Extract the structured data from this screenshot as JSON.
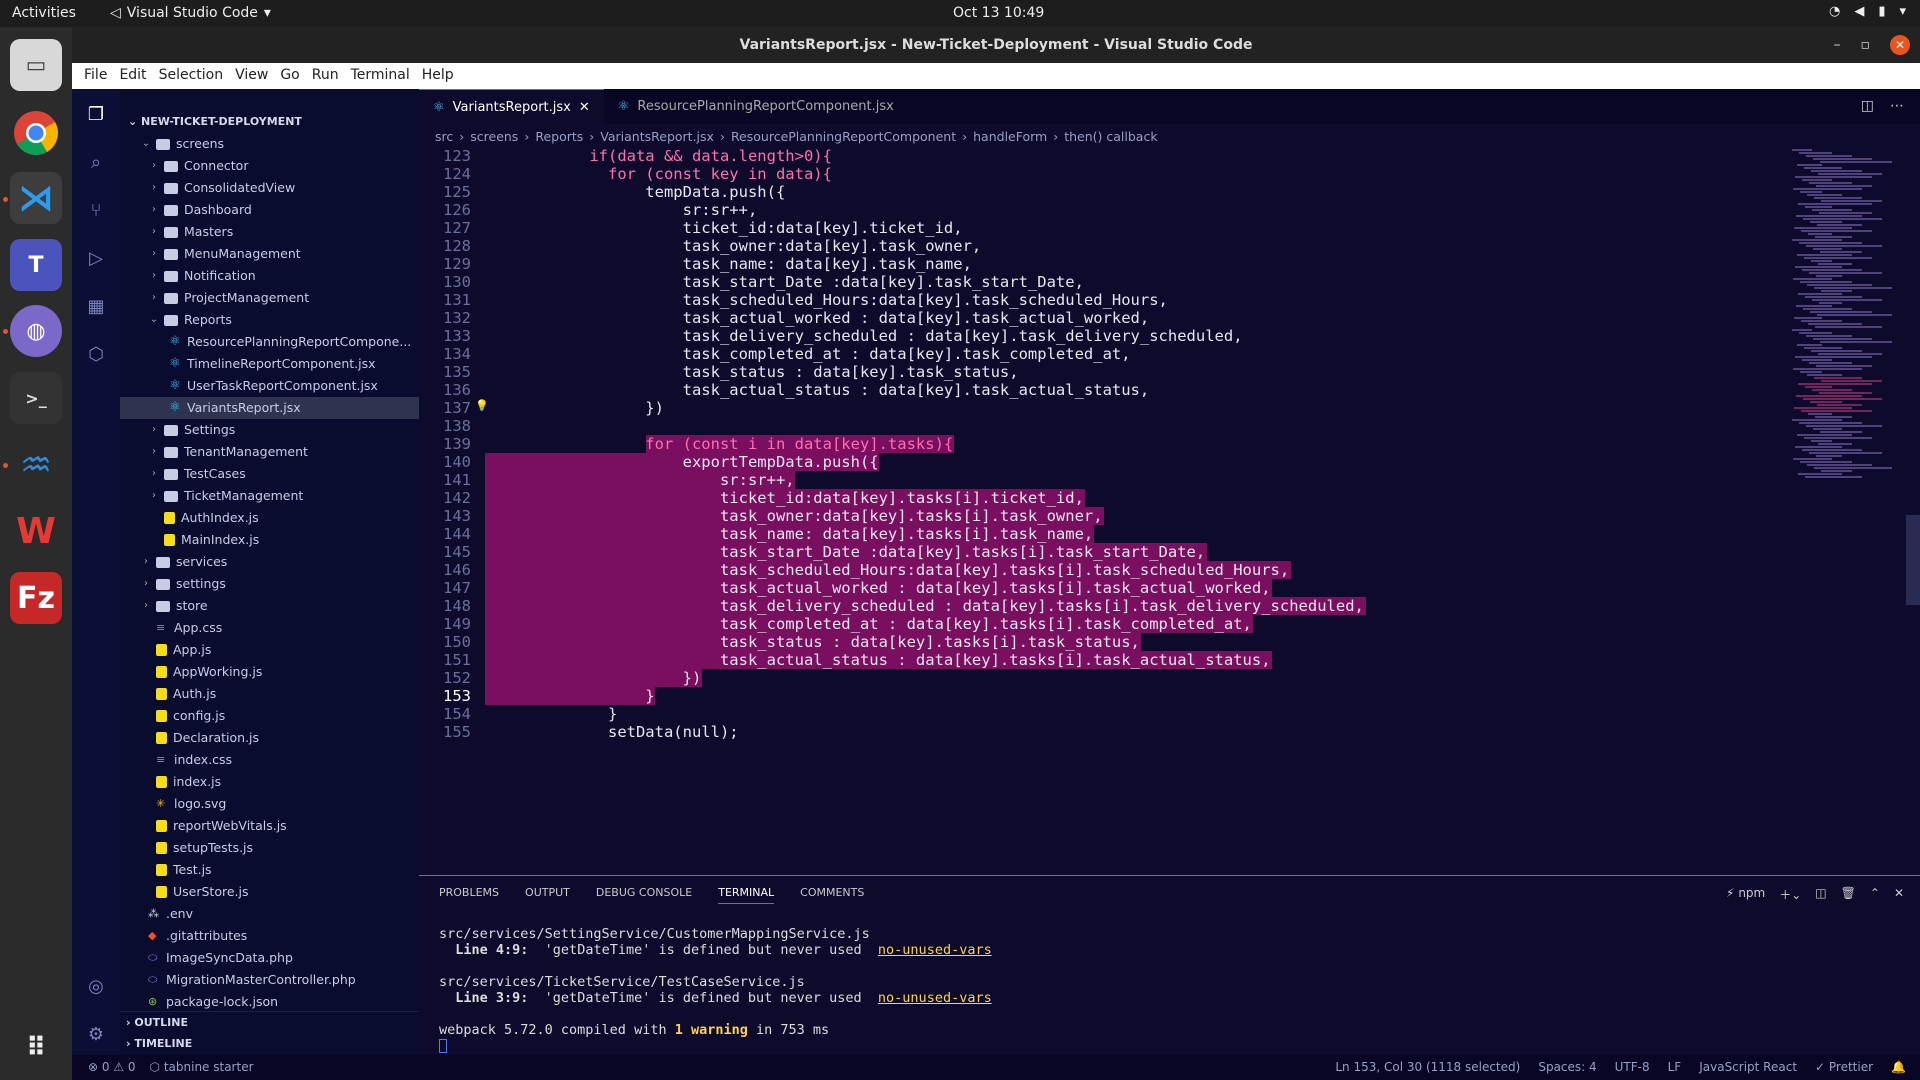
{
  "system": {
    "activities": "Activities",
    "app_name": "Visual Studio Code",
    "clock": "Oct 13  10:49"
  },
  "window": {
    "title": "VariantsReport.jsx - New-Ticket-Deployment - Visual Studio Code"
  },
  "menu": [
    "File",
    "Edit",
    "Selection",
    "View",
    "Go",
    "Run",
    "Terminal",
    "Help"
  ],
  "explorer": {
    "project": "NEW-TICKET-DEPLOYMENT",
    "items": [
      {
        "label": "screens",
        "type": "folder",
        "depth": 2,
        "open": true
      },
      {
        "label": "Connector",
        "type": "folder",
        "depth": 3
      },
      {
        "label": "ConsolidatedView",
        "type": "folder",
        "depth": 3
      },
      {
        "label": "Dashboard",
        "type": "folder",
        "depth": 3
      },
      {
        "label": "Masters",
        "type": "folder",
        "depth": 3
      },
      {
        "label": "MenuManagement",
        "type": "folder",
        "depth": 3
      },
      {
        "label": "Notification",
        "type": "folder",
        "depth": 3
      },
      {
        "label": "ProjectManagement",
        "type": "folder",
        "depth": 3
      },
      {
        "label": "Reports",
        "type": "folder",
        "depth": 3,
        "open": true
      },
      {
        "label": "ResourcePlanningReportCompone...",
        "type": "react",
        "depth": 4
      },
      {
        "label": "TimelineReportComponent.jsx",
        "type": "react",
        "depth": 4
      },
      {
        "label": "UserTaskReportComponent.jsx",
        "type": "react",
        "depth": 4
      },
      {
        "label": "VariantsReport.jsx",
        "type": "react",
        "depth": 4,
        "selected": true
      },
      {
        "label": "Settings",
        "type": "folder",
        "depth": 3
      },
      {
        "label": "TenantManagement",
        "type": "folder",
        "depth": 3
      },
      {
        "label": "TestCases",
        "type": "folder",
        "depth": 3
      },
      {
        "label": "TicketManagement",
        "type": "folder",
        "depth": 3
      },
      {
        "label": "AuthIndex.js",
        "type": "js",
        "depth": 3
      },
      {
        "label": "MainIndex.js",
        "type": "js",
        "depth": 3
      },
      {
        "label": "services",
        "type": "folder",
        "depth": 2
      },
      {
        "label": "settings",
        "type": "folder",
        "depth": 2
      },
      {
        "label": "store",
        "type": "folder",
        "depth": 2
      },
      {
        "label": "App.css",
        "type": "css",
        "depth": 2
      },
      {
        "label": "App.js",
        "type": "js",
        "depth": 2
      },
      {
        "label": "AppWorking.js",
        "type": "js",
        "depth": 2
      },
      {
        "label": "Auth.js",
        "type": "js",
        "depth": 2
      },
      {
        "label": "config.js",
        "type": "js",
        "depth": 2
      },
      {
        "label": "Declaration.js",
        "type": "js",
        "depth": 2
      },
      {
        "label": "index.css",
        "type": "css",
        "depth": 2
      },
      {
        "label": "index.js",
        "type": "js",
        "depth": 2
      },
      {
        "label": "logo.svg",
        "type": "svg",
        "depth": 2
      },
      {
        "label": "reportWebVitals.js",
        "type": "js",
        "depth": 2
      },
      {
        "label": "setupTests.js",
        "type": "js",
        "depth": 2
      },
      {
        "label": "Test.js",
        "type": "js",
        "depth": 2
      },
      {
        "label": "UserStore.js",
        "type": "js",
        "depth": 2
      },
      {
        "label": ".env",
        "type": "env",
        "depth": 1
      },
      {
        "label": ".gitattributes",
        "type": "git",
        "depth": 1
      },
      {
        "label": "ImageSyncData.php",
        "type": "php",
        "depth": 1
      },
      {
        "label": "MigrationMasterController.php",
        "type": "php",
        "depth": 1
      },
      {
        "label": "package-lock.json",
        "type": "json",
        "depth": 1
      }
    ],
    "outline": "OUTLINE",
    "timeline": "TIMELINE"
  },
  "tabs": [
    {
      "label": "VariantsReport.jsx",
      "active": true
    },
    {
      "label": "ResourcePlanningReportComponent.jsx",
      "active": false
    }
  ],
  "breadcrumb": [
    "src",
    "screens",
    "Reports",
    "VariantsReport.jsx",
    "ResourcePlanningReportComponent",
    "handleForm",
    "then() callback"
  ],
  "code": {
    "current_line": 153,
    "lines": [
      {
        "n": 123,
        "t": "          if(data && data.length>0){"
      },
      {
        "n": 124,
        "t": "            for (const key in data){"
      },
      {
        "n": 125,
        "t": "                tempData.push({"
      },
      {
        "n": 126,
        "t": "                    sr:sr++,"
      },
      {
        "n": 127,
        "t": "                    ticket_id:data[key].ticket_id,"
      },
      {
        "n": 128,
        "t": "                    task_owner:data[key].task_owner,"
      },
      {
        "n": 129,
        "t": "                    task_name: data[key].task_name,"
      },
      {
        "n": 130,
        "t": "                    task_start_Date :data[key].task_start_Date,"
      },
      {
        "n": 131,
        "t": "                    task_scheduled_Hours:data[key].task_scheduled_Hours,"
      },
      {
        "n": 132,
        "t": "                    task_actual_worked : data[key].task_actual_worked,"
      },
      {
        "n": 133,
        "t": "                    task_delivery_scheduled : data[key].task_delivery_scheduled,"
      },
      {
        "n": 134,
        "t": "                    task_completed_at : data[key].task_completed_at,"
      },
      {
        "n": 135,
        "t": "                    task_status : data[key].task_status,"
      },
      {
        "n": 136,
        "t": "                    task_actual_status : data[key].task_actual_status,"
      },
      {
        "n": 137,
        "t": "                })"
      },
      {
        "n": 138,
        "t": ""
      },
      {
        "n": 139,
        "t": "                for (const i in data[key].tasks){"
      },
      {
        "n": 140,
        "t": "                    exportTempData.push({"
      },
      {
        "n": 141,
        "t": "                        sr:sr++,"
      },
      {
        "n": 142,
        "t": "                        ticket_id:data[key].tasks[i].ticket_id,"
      },
      {
        "n": 143,
        "t": "                        task_owner:data[key].tasks[i].task_owner,"
      },
      {
        "n": 144,
        "t": "                        task_name: data[key].tasks[i].task_name,"
      },
      {
        "n": 145,
        "t": "                        task_start_Date :data[key].tasks[i].task_start_Date,"
      },
      {
        "n": 146,
        "t": "                        task_scheduled_Hours:data[key].tasks[i].task_scheduled_Hours,"
      },
      {
        "n": 147,
        "t": "                        task_actual_worked : data[key].tasks[i].task_actual_worked,"
      },
      {
        "n": 148,
        "t": "                        task_delivery_scheduled : data[key].tasks[i].task_delivery_scheduled,"
      },
      {
        "n": 149,
        "t": "                        task_completed_at : data[key].tasks[i].task_completed_at,"
      },
      {
        "n": 150,
        "t": "                        task_status : data[key].tasks[i].task_status,"
      },
      {
        "n": 151,
        "t": "                        task_actual_status : data[key].tasks[i].task_actual_status,"
      },
      {
        "n": 152,
        "t": "                    })"
      },
      {
        "n": 153,
        "t": "                }"
      },
      {
        "n": 154,
        "t": "            }"
      },
      {
        "n": 155,
        "t": "            setData(null);"
      }
    ]
  },
  "panel": {
    "tabs": [
      "PROBLEMS",
      "OUTPUT",
      "DEBUG CONSOLE",
      "TERMINAL",
      "COMMENTS"
    ],
    "active_tab": "TERMINAL",
    "shell": "npm",
    "terminal": {
      "file1": "src/services/SettingService/CustomerMappingService.js",
      "line1_loc": "Line 4:9:",
      "line1_msg": "  'getDateTime' is defined but never used  ",
      "rule1": "no-unused-vars",
      "file2": "src/services/TicketService/TestCaseService.js",
      "line2_loc": "Line 3:9:",
      "line2_msg": "  'getDateTime' is defined but never used  ",
      "rule2": "no-unused-vars",
      "compile_a": "webpack 5.72.0 compiled with ",
      "compile_b": "1 warning",
      "compile_c": " in 753 ms"
    }
  },
  "status": {
    "problems": "⊗ 0 ⚠ 0",
    "tabnine": "tabnine starter",
    "position": "Ln 153, Col 30 (1118 selected)",
    "spaces": "Spaces: 4",
    "encoding": "UTF-8",
    "eol": "LF",
    "language": "JavaScript React",
    "prettier": "✓ Prettier"
  }
}
